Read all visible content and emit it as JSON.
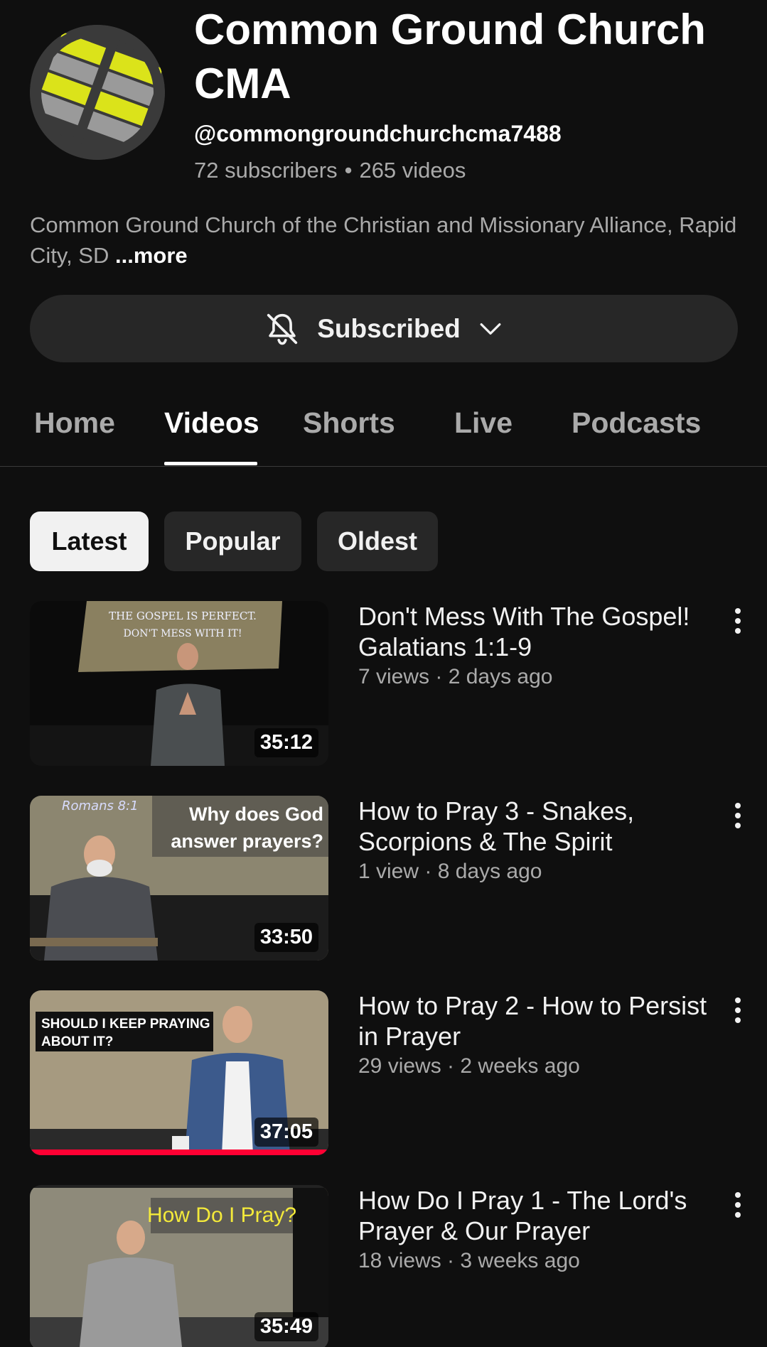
{
  "channel": {
    "title": "Common Ground Church CMA",
    "handle": "@commongroundchurchcma7488",
    "subscribers": "72 subscribers",
    "videos": "265 videos",
    "description": "Common Ground Church of the Christian and Missionary Alliance, Rapid City, SD",
    "more_label": "...more",
    "logo_colors": {
      "accent": "#dbe31a",
      "stripe": "#9a9a9a",
      "ring": "#3a3a3a"
    }
  },
  "subscribe": {
    "label": "Subscribed",
    "icon": "bell-off-icon",
    "chevron_icon": "chevron-down-icon"
  },
  "tabs": [
    {
      "label": "Home",
      "active": false
    },
    {
      "label": "Videos",
      "active": true
    },
    {
      "label": "Shorts",
      "active": false
    },
    {
      "label": "Live",
      "active": false
    },
    {
      "label": "Podcasts",
      "active": false
    }
  ],
  "chips": [
    {
      "label": "Latest",
      "active": true
    },
    {
      "label": "Popular",
      "active": false
    },
    {
      "label": "Oldest",
      "active": false
    }
  ],
  "videos": [
    {
      "title": "Don't Mess With The Gospel! Galatians 1:1-9",
      "meta": "7 views · 2 days ago",
      "duration": "35:12",
      "thumb_text_1": "THE GOSPEL IS PERFECT.",
      "thumb_text_2": "DON'T MESS WITH IT!"
    },
    {
      "title": "How to Pray 3 - Snakes, Scorpions & The Spirit",
      "meta": "1 view · 8 days ago",
      "duration": "33:50",
      "thumb_text_1": "Why does God",
      "thumb_text_2": "answer prayers?",
      "thumb_text_3": "Romans 8:1"
    },
    {
      "title": "How to Pray 2 - How to Persist in Prayer",
      "meta": "29 views · 2 weeks ago",
      "duration": "37:05",
      "thumb_text_1": "SHOULD I KEEP PRAYING",
      "thumb_text_2": "ABOUT IT?",
      "watch_progress": 1.0
    },
    {
      "title": "How Do I Pray 1 - The Lord's Prayer & Our Prayer",
      "meta": "18 views · 3 weeks ago",
      "duration": "35:49",
      "thumb_text_1": "How Do I Pray?"
    }
  ]
}
